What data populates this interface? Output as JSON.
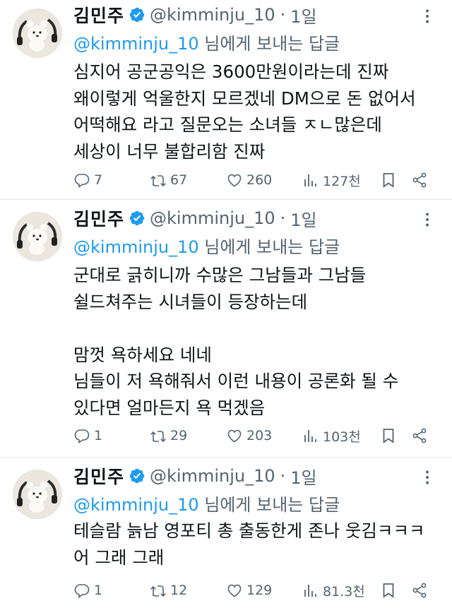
{
  "tweets": [
    {
      "name": "김민주",
      "handle": "@kimminju_10",
      "separator": "·",
      "time": "1일",
      "reply_mention": "@kimminju_10",
      "reply_suffix": " 님에게 보내는 답글",
      "lines": [
        "심지어 공군공익은 3600만원이라는데 진짜",
        "왜이렇게 억울한지 모르겠네 DM으로 돈 없어서",
        "어떡해요 라고 질문오는 소녀들 ㅈㄴ많은데",
        "세상이 너무 불합리함 진짜"
      ],
      "stats": {
        "replies": "7",
        "retweets": "67",
        "likes": "260",
        "views": "127천"
      }
    },
    {
      "name": "김민주",
      "handle": "@kimminju_10",
      "separator": "·",
      "time": "1일",
      "reply_mention": "@kimminju_10",
      "reply_suffix": " 님에게 보내는 답글",
      "lines": [
        "군대로 긁히니까 수많은 그남들과 그남들",
        "쉴드쳐주는 시녀들이 등장하는데",
        "",
        "맘껏 욕하세요 네네",
        "님들이 저 욕해줘서 이런 내용이 공론화 될 수",
        "있다면 얼마든지 욕 먹겠음"
      ],
      "stats": {
        "replies": "1",
        "retweets": "29",
        "likes": "203",
        "views": "103천"
      }
    },
    {
      "name": "김민주",
      "handle": "@kimminju_10",
      "separator": "·",
      "time": "1일",
      "reply_mention": "@kimminju_10",
      "reply_suffix": " 님에게 보내는 답글",
      "lines": [
        "테슬람 늙남 영포티 총 출동한게 존나 웃김ㅋㅋㅋ",
        "어 그래 그래"
      ],
      "stats": {
        "replies": "1",
        "retweets": "12",
        "likes": "129",
        "views": "81.3천"
      }
    }
  ],
  "icons": {
    "verified": "verified-badge-icon",
    "more": "more-options-icon",
    "reply": "reply-icon",
    "retweet": "retweet-icon",
    "like": "like-icon",
    "views": "views-icon",
    "bookmark": "bookmark-icon",
    "share": "share-icon"
  },
  "colors": {
    "accent": "#1d9bf0",
    "muted": "#536471",
    "text": "#0f1419",
    "divider": "#e4e8eb"
  }
}
